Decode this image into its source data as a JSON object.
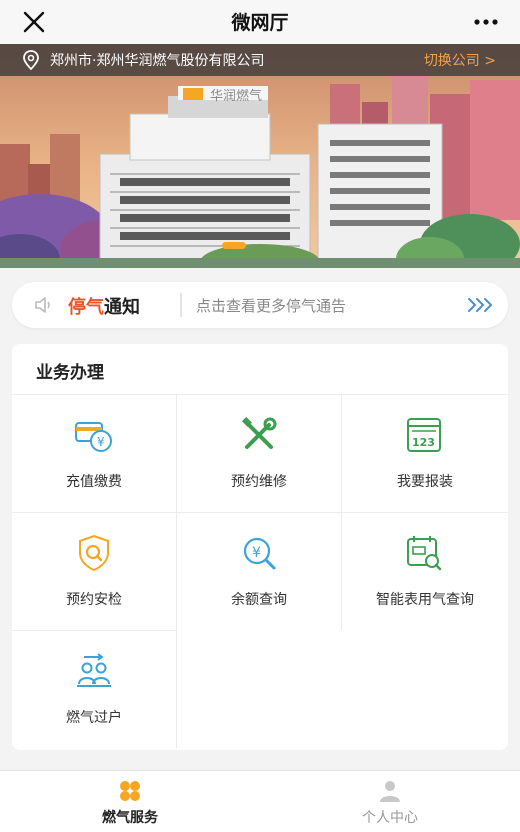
{
  "header": {
    "title": "微网厅",
    "close_icon": "close-icon",
    "more_icon": "more-dots-icon"
  },
  "location": {
    "text": "郑州市·郑州华润燃气股份有限公司",
    "switch_label": "切换公司 >"
  },
  "banner": {
    "logo_text": "华润燃气",
    "slide": 1
  },
  "notice": {
    "title_red": "停气",
    "title_dark": "通知",
    "text": "点击查看更多停气通告",
    "accent": "#e8552a"
  },
  "services": {
    "heading": "业务办理",
    "items": [
      {
        "label": "充值缴费",
        "icon": "recharge-card-icon"
      },
      {
        "label": "预约维修",
        "icon": "repair-tools-icon"
      },
      {
        "label": "我要报装",
        "icon": "meter-123-icon"
      },
      {
        "label": "预约安检",
        "icon": "shield-search-icon"
      },
      {
        "label": "余额查询",
        "icon": "balance-search-icon"
      },
      {
        "label": "智能表用气查询",
        "icon": "smart-meter-search-icon"
      },
      {
        "label": "燃气过户",
        "icon": "transfer-users-icon"
      }
    ]
  },
  "tabbar": {
    "tabs": [
      {
        "label": "燃气服务",
        "active": true
      },
      {
        "label": "个人中心",
        "active": false
      }
    ]
  },
  "colors": {
    "orange": "#f5a623",
    "blue": "#3aa3d8",
    "green": "#3c9e4f",
    "red": "#e8552a"
  }
}
